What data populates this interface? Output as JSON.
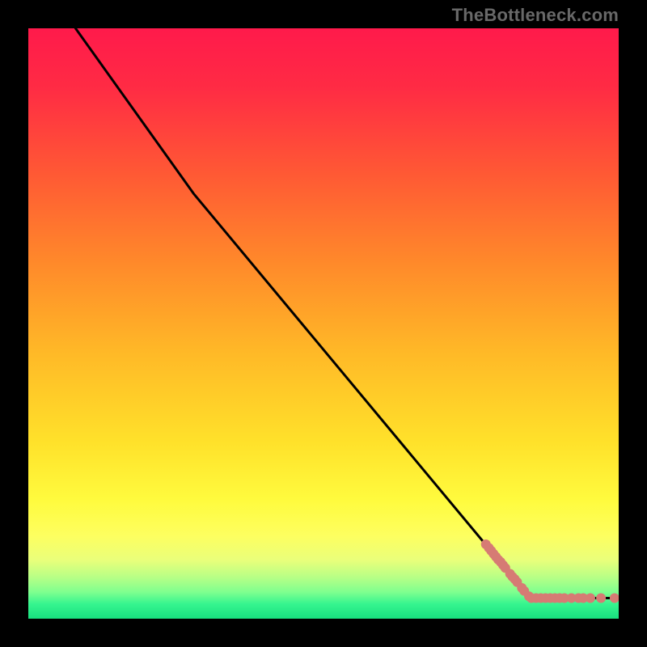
{
  "watermark": "TheBottleneck.com",
  "colors": {
    "gradient_stops": [
      {
        "offset": 0.0,
        "color": "#ff1a4b"
      },
      {
        "offset": 0.1,
        "color": "#ff2b44"
      },
      {
        "offset": 0.25,
        "color": "#ff5a34"
      },
      {
        "offset": 0.4,
        "color": "#ff8a2a"
      },
      {
        "offset": 0.55,
        "color": "#ffb927"
      },
      {
        "offset": 0.7,
        "color": "#ffe12a"
      },
      {
        "offset": 0.8,
        "color": "#fffb3e"
      },
      {
        "offset": 0.86,
        "color": "#fdff60"
      },
      {
        "offset": 0.9,
        "color": "#eaff7a"
      },
      {
        "offset": 0.93,
        "color": "#b7ff86"
      },
      {
        "offset": 0.955,
        "color": "#7fff8f"
      },
      {
        "offset": 0.975,
        "color": "#36f58f"
      },
      {
        "offset": 1.0,
        "color": "#18e07f"
      }
    ],
    "line": "#000000",
    "point": "#d67b74",
    "background": "#000000"
  },
  "chart_data": {
    "type": "line",
    "title": "",
    "xlabel": "",
    "ylabel": "",
    "xlim": [
      0,
      100
    ],
    "ylim": [
      0,
      100
    ],
    "grid": false,
    "legend": false,
    "series": [
      {
        "name": "curve",
        "kind": "line",
        "x": [
          8,
          28,
          85,
          100
        ],
        "y": [
          100,
          72,
          3.5,
          3.5
        ]
      },
      {
        "name": "points",
        "kind": "scatter",
        "points": [
          {
            "x": 77.5,
            "y": 12.6
          },
          {
            "x": 78.0,
            "y": 12.0
          },
          {
            "x": 78.4,
            "y": 11.5
          },
          {
            "x": 78.8,
            "y": 11.0
          },
          {
            "x": 79.2,
            "y": 10.5
          },
          {
            "x": 79.6,
            "y": 10.0
          },
          {
            "x": 80.0,
            "y": 9.6
          },
          {
            "x": 80.4,
            "y": 9.1
          },
          {
            "x": 80.8,
            "y": 8.6
          },
          {
            "x": 81.6,
            "y": 7.6
          },
          {
            "x": 82.0,
            "y": 7.1
          },
          {
            "x": 82.4,
            "y": 6.7
          },
          {
            "x": 82.8,
            "y": 6.2
          },
          {
            "x": 83.6,
            "y": 5.2
          },
          {
            "x": 84.0,
            "y": 4.7
          },
          {
            "x": 84.8,
            "y": 3.8
          },
          {
            "x": 85.2,
            "y": 3.5
          },
          {
            "x": 86.0,
            "y": 3.5
          },
          {
            "x": 86.8,
            "y": 3.5
          },
          {
            "x": 87.6,
            "y": 3.5
          },
          {
            "x": 88.4,
            "y": 3.5
          },
          {
            "x": 89.2,
            "y": 3.5
          },
          {
            "x": 90.0,
            "y": 3.5
          },
          {
            "x": 90.8,
            "y": 3.5
          },
          {
            "x": 92.0,
            "y": 3.5
          },
          {
            "x": 93.2,
            "y": 3.5
          },
          {
            "x": 94.0,
            "y": 3.5
          },
          {
            "x": 95.2,
            "y": 3.5
          },
          {
            "x": 97.0,
            "y": 3.5
          },
          {
            "x": 99.3,
            "y": 3.5
          }
        ]
      }
    ]
  }
}
